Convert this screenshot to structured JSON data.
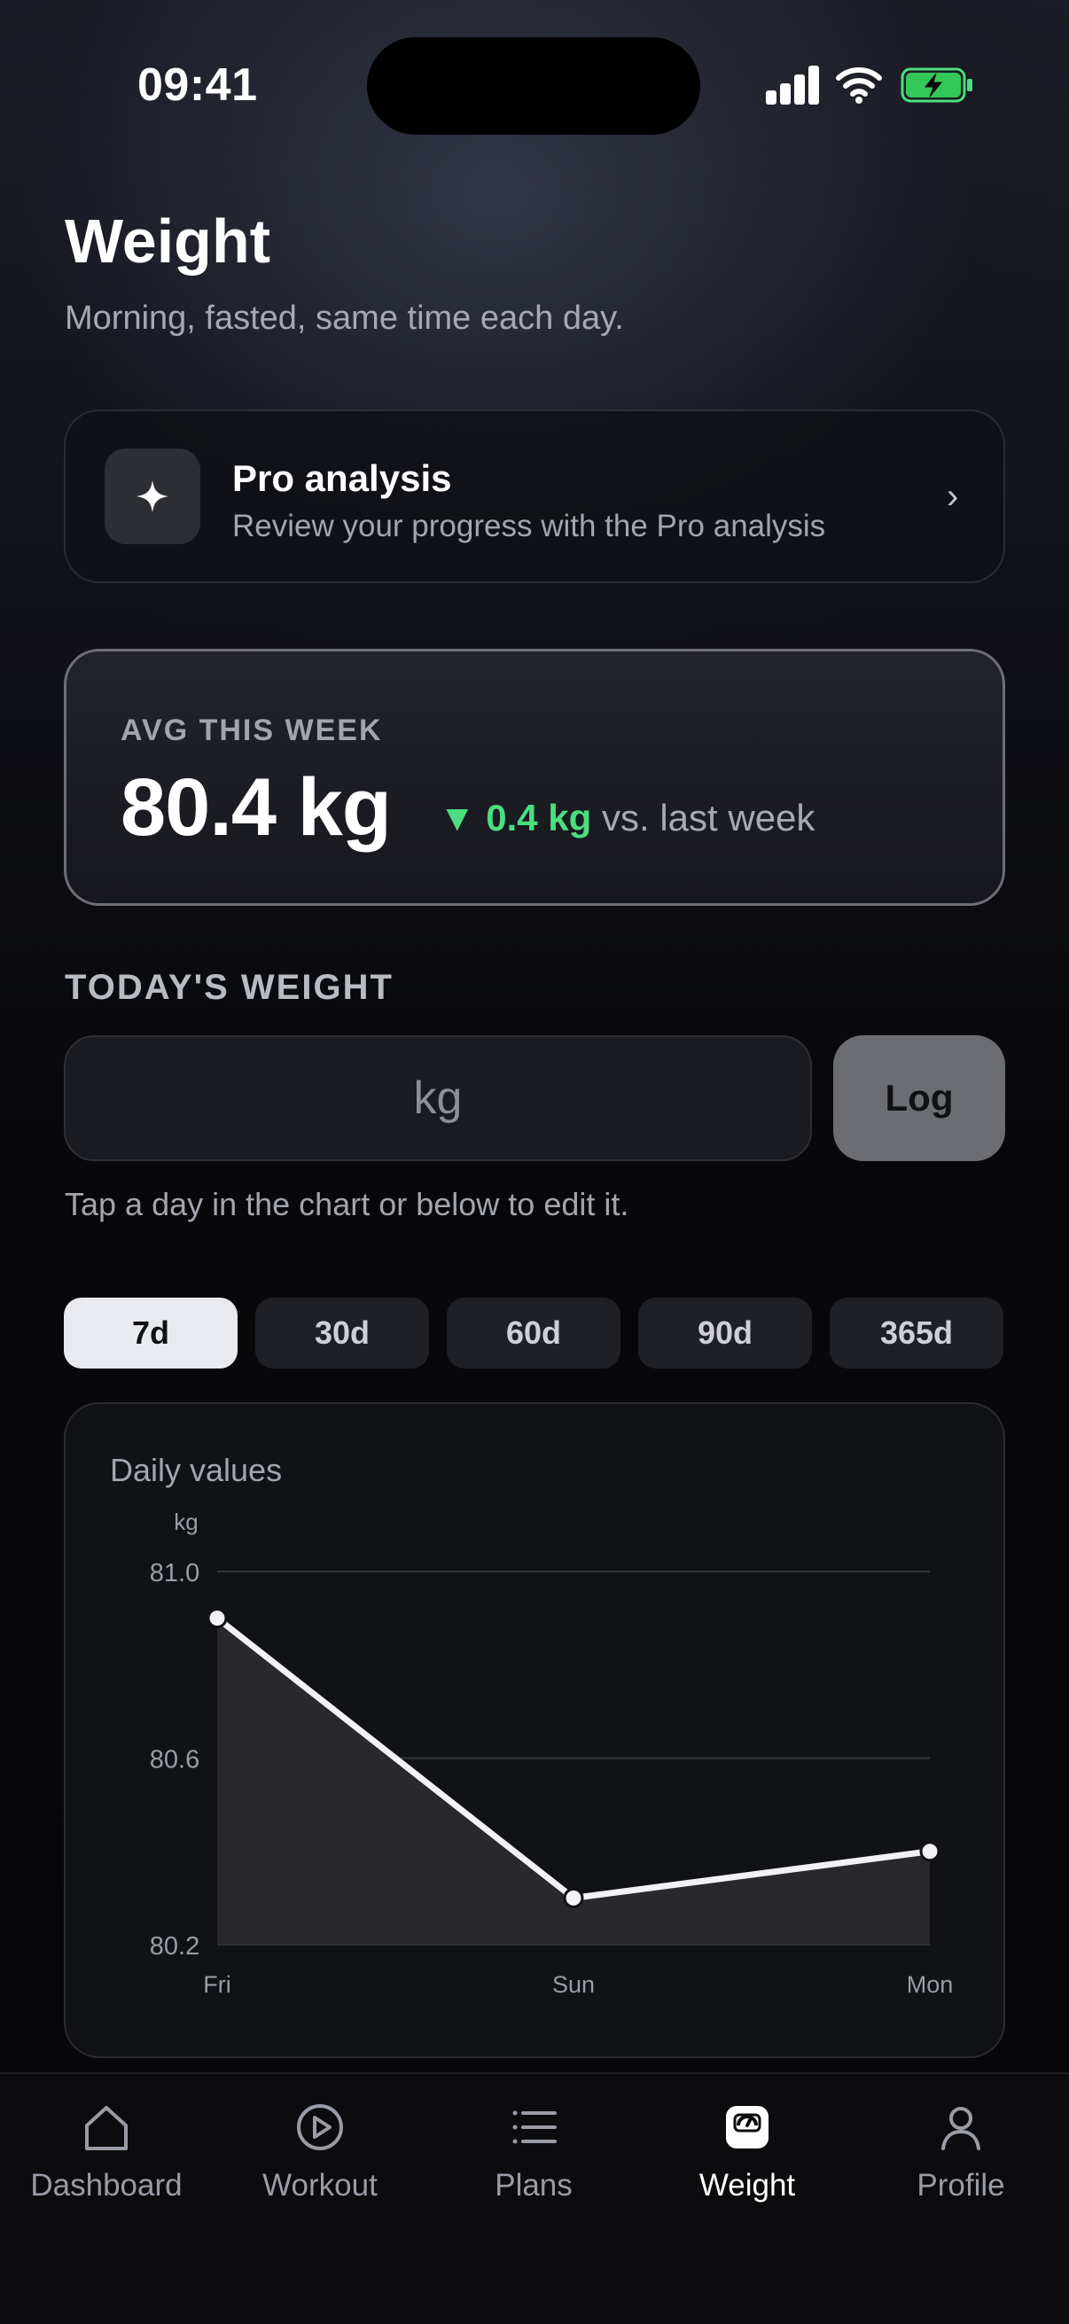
{
  "status_bar": {
    "time": "09:41"
  },
  "header": {
    "title": "Weight",
    "subtitle": "Morning, fasted, same time each day."
  },
  "pro_card": {
    "icon": "sparkle-icon",
    "title": "Pro analysis",
    "description": "Review your progress with the Pro analysis",
    "chevron": "›"
  },
  "avg_card": {
    "label": "AVG THIS WEEK",
    "value": "80.4 kg",
    "delta_arrow": "▼",
    "delta_value": "0.4 kg",
    "delta_suffix": "vs. last week",
    "delta_color": "#4ade80"
  },
  "today": {
    "section_label": "TODAY'S WEIGHT",
    "input_value": "",
    "input_placeholder": "kg",
    "log_label": "Log",
    "hint": "Tap a day in the chart or below to edit it."
  },
  "range_tabs": [
    {
      "label": "7d",
      "active": true
    },
    {
      "label": "30d",
      "active": false
    },
    {
      "label": "60d",
      "active": false
    },
    {
      "label": "90d",
      "active": false
    },
    {
      "label": "365d",
      "active": false
    }
  ],
  "chart_card": {
    "heading": "Daily values"
  },
  "chart_data": {
    "type": "area",
    "title": "",
    "xlabel": "",
    "ylabel": "kg",
    "categories": [
      "Fri",
      "Sun",
      "Mon"
    ],
    "series": [
      {
        "values": [
          80.9,
          80.3,
          80.4
        ]
      }
    ],
    "y_ticks": [
      "81.0",
      "80.6",
      "80.2"
    ],
    "ylim": [
      80.2,
      81.0
    ],
    "grid": true,
    "line_color": "#f2f2f4",
    "fill_color": "#2a2a2e"
  },
  "bottom_nav": [
    {
      "label": "Dashboard",
      "icon": "home-icon",
      "active": false
    },
    {
      "label": "Workout",
      "icon": "play-circle-icon",
      "active": false
    },
    {
      "label": "Plans",
      "icon": "list-icon",
      "active": false
    },
    {
      "label": "Weight",
      "icon": "scale-icon",
      "active": true
    },
    {
      "label": "Profile",
      "icon": "person-icon",
      "active": false
    }
  ]
}
